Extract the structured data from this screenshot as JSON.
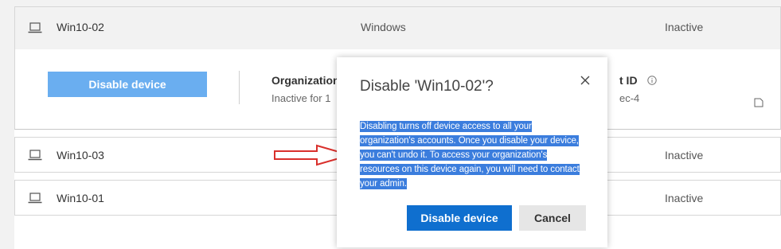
{
  "devices": [
    {
      "name": "Win10-02",
      "os": "Windows",
      "status": "Inactive"
    },
    {
      "name": "Win10-03",
      "os": "",
      "status": "Inactive"
    },
    {
      "name": "Win10-01",
      "os": "",
      "status": "Inactive"
    }
  ],
  "details": {
    "disable_button": "Disable device",
    "org_label": "Organization",
    "org_value": "Inactive for 1",
    "tenant_label": "t ID",
    "tenant_value": "ec-4"
  },
  "dialog": {
    "title": "Disable 'Win10-02'?",
    "body": "Disabling turns off device access to all your organization's accounts. Once you disable your device, you can't undo it. To access your organization's resources on this device again, you will need to contact your admin.",
    "confirm": "Disable device",
    "cancel": "Cancel"
  },
  "colors": {
    "primary": "#0f6fcf",
    "primary_light": "#6aaef0",
    "selection": "#3b7ddd",
    "arrow": "#d9302c"
  },
  "icons": [
    "laptop-icon",
    "info-icon",
    "copy-icon",
    "close-icon",
    "arrow-annotation"
  ]
}
